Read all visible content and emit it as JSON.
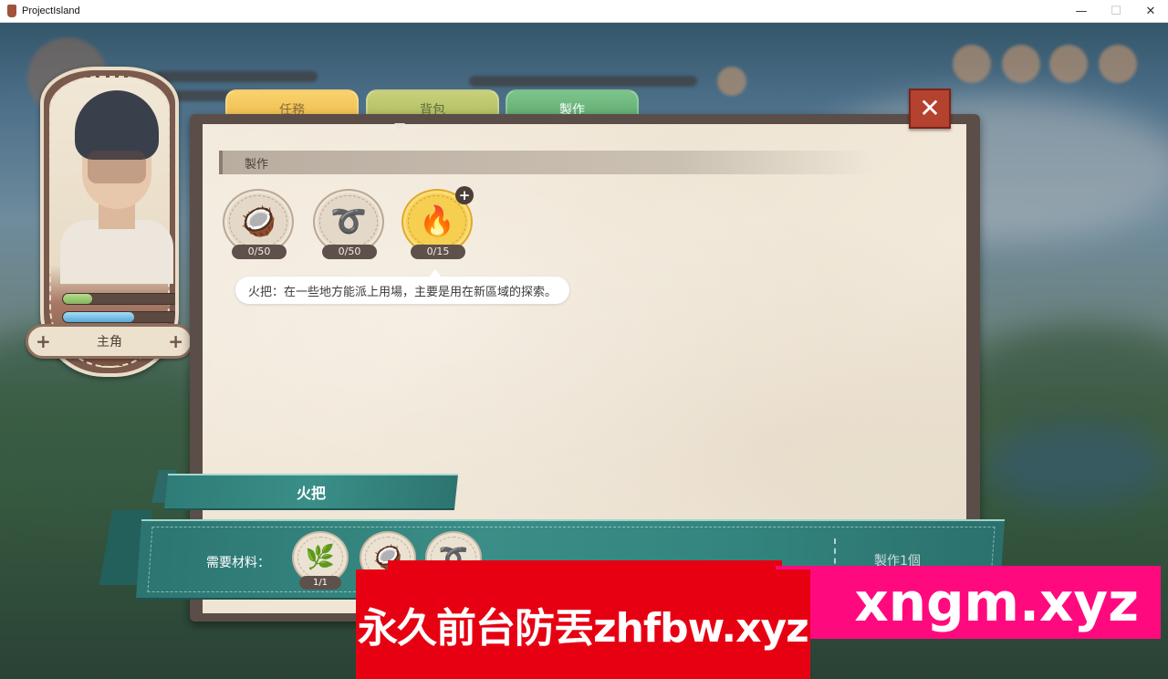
{
  "window": {
    "title": "ProjectIsland",
    "minimize_glyph": "—",
    "maximize_glyph": "☐",
    "close_glyph": "✕"
  },
  "character": {
    "name": "主角",
    "plus_glyph": "+",
    "hp_fill": 0.25,
    "mp_fill": 0.62,
    "hp_color": "#84b55e",
    "mp_color": "#54a8d8"
  },
  "tabs": [
    {
      "label": "任務",
      "color": "#eeb744"
    },
    {
      "label": "背包",
      "color": "#a9b85a"
    },
    {
      "label": "製作",
      "color": "#56a36a",
      "active": true
    }
  ],
  "close_button": {
    "glyph": "✕",
    "color": "#b5412f"
  },
  "section": {
    "title": "製作"
  },
  "items": [
    {
      "icon": "coconut-icon",
      "glyph": "🥥",
      "count": "0/50"
    },
    {
      "icon": "rope-icon",
      "glyph": "➰",
      "count": "0/50"
    },
    {
      "icon": "torch-icon",
      "glyph": "🔥",
      "count": "0/15",
      "selected": true
    }
  ],
  "add_badge": "+",
  "tooltip": "火把：在一些地方能派上用場，主要是用在新區域的探索。",
  "recipe": {
    "title": "火把",
    "materials_label": "需要材料：",
    "materials": [
      {
        "icon": "stick-icon",
        "glyph": "🌿",
        "count": "1/1"
      },
      {
        "icon": "coconut-icon",
        "glyph": "🥥"
      },
      {
        "icon": "rope-icon",
        "glyph": "➰"
      }
    ],
    "craft_button": "製作1個"
  },
  "ads": {
    "red_text": "永久前台防丟zhfbw.xyz",
    "pink_text": "xngm.xyz",
    "red_color": "#e60012",
    "pink_color": "#ff0a7e"
  }
}
